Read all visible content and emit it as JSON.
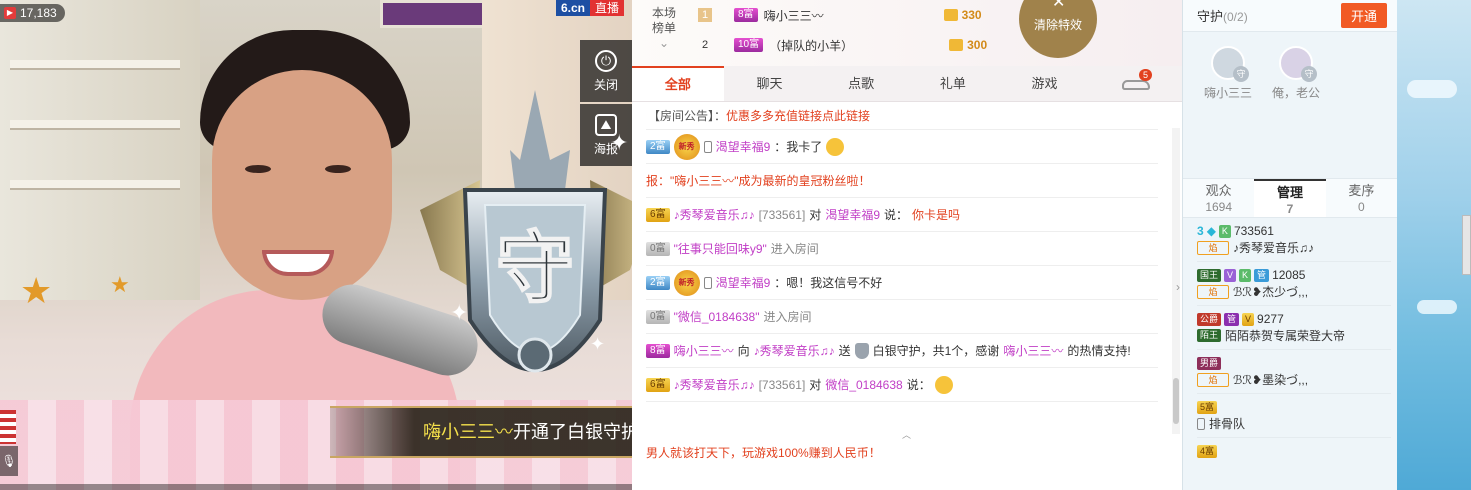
{
  "video": {
    "viewer_count": "17,183",
    "logo": "6.cn",
    "logo_tag": "直播",
    "side_buttons": [
      {
        "label": "关闭",
        "icon": "power-icon"
      },
      {
        "label": "海报",
        "icon": "poster-icon"
      }
    ],
    "shield_char": "守",
    "banner_name": "嗨小三三〰",
    "banner_text": "开通了白银守护！"
  },
  "rank": {
    "label_line1": "本场",
    "label_line2": "榜单",
    "rows": [
      {
        "n": "1",
        "level": "8富",
        "name": "嗨小三三〰",
        "coins": "330"
      },
      {
        "n": "2",
        "level": "10富",
        "name": "（掉队的小羊）",
        "coins": "300"
      }
    ],
    "clear_effects": "清除特效"
  },
  "tabs": [
    {
      "label": "全部"
    },
    {
      "label": "聊天"
    },
    {
      "label": "点歌"
    },
    {
      "label": "礼单"
    },
    {
      "label": "游戏"
    }
  ],
  "tabs_badge": "5",
  "notice": {
    "prefix": "【房间公告】：",
    "text": "优惠多多充值链接点此链接"
  },
  "messages": {
    "m1": {
      "level": "2富",
      "badge": "新秀",
      "name": "渴望幸福9",
      "text": "：我卡了"
    },
    "m2": {
      "text": "报：\"嗨小三三〰\"成为最新的皇冠粉丝啦！"
    },
    "m3": {
      "level": "6富",
      "name": "♪秀琴爱音乐♫♪",
      "id": "[733561]",
      "to": "对",
      "target": "渴望幸福9",
      "say": "说：",
      "text": "你卡是吗"
    },
    "m4": {
      "level": "0富",
      "name": "\"往事只能回味y9\"",
      "text": "进入房间"
    },
    "m5": {
      "level": "2富",
      "badge": "新秀",
      "name": "渴望幸福9",
      "text": "：嗯！我这信号不好"
    },
    "m6": {
      "level": "0富",
      "name": "\"微信_0184638\"",
      "text": "进入房间"
    },
    "m7": {
      "level": "8富",
      "name": "嗨小三三〰",
      "to": "向",
      "target": "♪秀琴爱音乐♫♪",
      "send": "送",
      "gift": "白银守护，共1个，感谢",
      "thanks_name": "嗨小三三〰",
      "tail": "的热情支持!"
    },
    "m8": {
      "level": "6富",
      "name": "♪秀琴爱音乐♫♪",
      "id": "[733561]",
      "to": "对",
      "target": "微信_0184638",
      "say": "说："
    }
  },
  "last_line": "男人就该打天下，玩游戏100%赚到人民币！",
  "guard": {
    "title": "守护",
    "count": "(0/2)",
    "open_label": "开通",
    "members": [
      {
        "name": "嗨小三三"
      },
      {
        "name": "俺，老公"
      }
    ]
  },
  "right_tabs": [
    {
      "label": "观众",
      "num": "1694"
    },
    {
      "label": "管理",
      "num": "7"
    },
    {
      "label": "麦序",
      "num": "0"
    }
  ],
  "managers": [
    {
      "r1_prefix": "3",
      "r1_id": "733561",
      "name": "♪秀琴爱音乐♫♪"
    },
    {
      "r1_tag": "国王",
      "r1_id": "12085",
      "name": "ℬℛ❥杰少づ,,,"
    },
    {
      "r1_tag": "公爵",
      "r1_id": "9277",
      "r2_tag": "陌王",
      "name": "陌陌恭贺专属荣登大帝"
    },
    {
      "r1_tag": "男爵",
      "name": "ℬℛ❥墨染づ,,,"
    },
    {
      "r1_tag": "5富",
      "name": "排骨队"
    },
    {
      "r1_tag": "4富"
    }
  ],
  "manager_flame": "焰",
  "manager_tags": {
    "v": "V",
    "k": "K",
    "g": "管"
  }
}
